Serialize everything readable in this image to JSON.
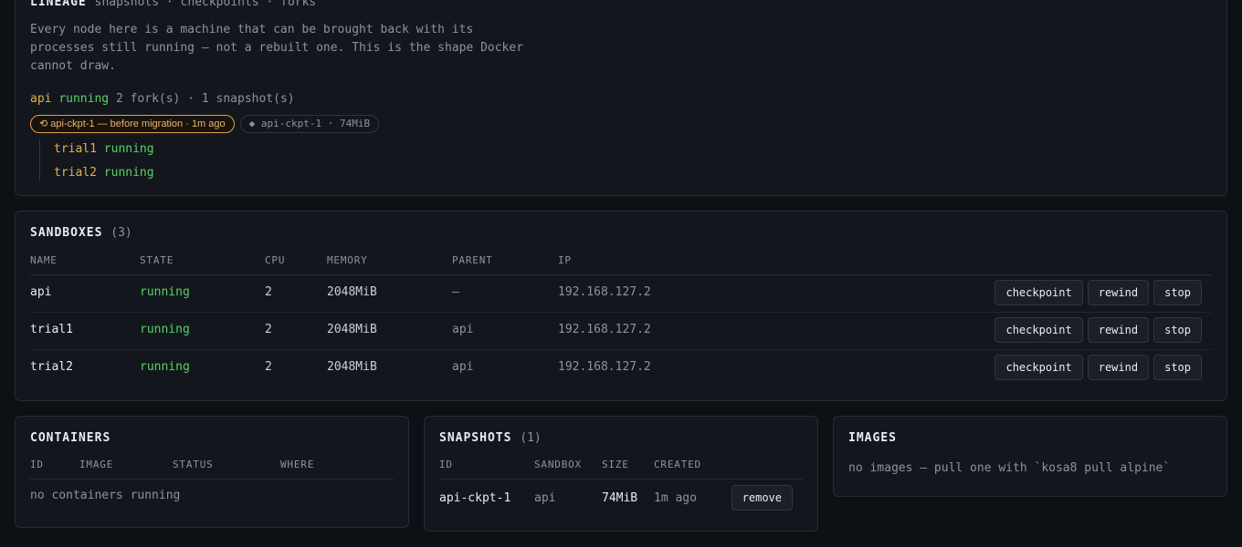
{
  "lineage": {
    "title": "LINEAGE",
    "subtitle": "snapshots · checkpoints · forks",
    "description": "Every node here is a machine that can be brought back with its processes still running — not a rebuilt one. This is the shape Docker cannot draw.",
    "root": {
      "name": "api",
      "state": "running",
      "meta": "2 fork(s) · 1 snapshot(s)"
    },
    "checkpoint_chip": "⟲ api-ckpt-1 — before migration · 1m ago",
    "snapshot_chip": "◆ api-ckpt-1 · 74MiB",
    "children": [
      {
        "name": "trial1",
        "state": "running"
      },
      {
        "name": "trial2",
        "state": "running"
      }
    ]
  },
  "sandboxes": {
    "title": "SANDBOXES",
    "count": "(3)",
    "columns": [
      "NAME",
      "STATE",
      "CPU",
      "MEMORY",
      "PARENT",
      "IP"
    ],
    "rows": [
      {
        "name": "api",
        "state": "running",
        "cpu": "2",
        "memory": "2048MiB",
        "parent": "—",
        "ip": "192.168.127.2"
      },
      {
        "name": "trial1",
        "state": "running",
        "cpu": "2",
        "memory": "2048MiB",
        "parent": "api",
        "ip": "192.168.127.2"
      },
      {
        "name": "trial2",
        "state": "running",
        "cpu": "2",
        "memory": "2048MiB",
        "parent": "api",
        "ip": "192.168.127.2"
      }
    ],
    "actions": {
      "checkpoint": "checkpoint",
      "rewind": "rewind",
      "stop": "stop"
    }
  },
  "containers": {
    "title": "CONTAINERS",
    "columns": [
      "ID",
      "IMAGE",
      "STATUS",
      "WHERE"
    ],
    "empty": "no containers running"
  },
  "snapshots": {
    "title": "SNAPSHOTS",
    "count": "(1)",
    "columns": [
      "ID",
      "SANDBOX",
      "SIZE",
      "CREATED"
    ],
    "rows": [
      {
        "id": "api-ckpt-1",
        "sandbox": "api",
        "size": "74MiB",
        "created": "1m ago",
        "action": "remove"
      }
    ]
  },
  "images": {
    "title": "IMAGES",
    "empty": "no images — pull one with `kosa8 pull alpine`"
  },
  "colors": {
    "accent": "#e3b341",
    "running": "#56d364",
    "chip_border": "#e3a04a"
  }
}
